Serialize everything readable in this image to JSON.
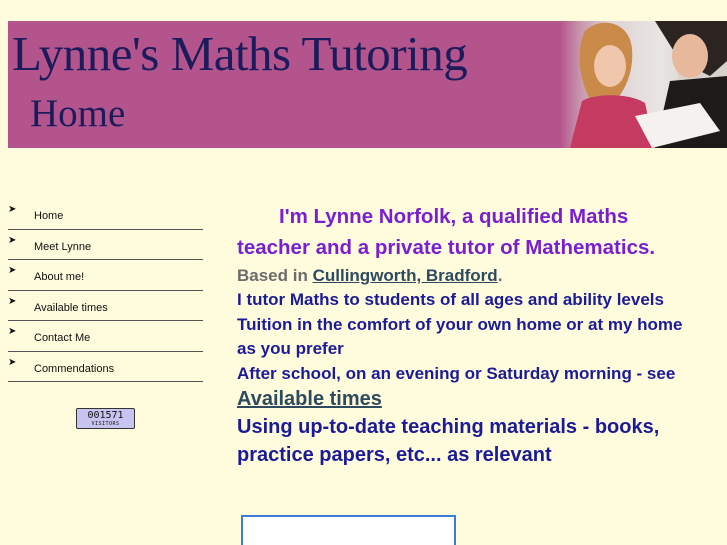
{
  "header": {
    "title": "Lynne's Maths Tutoring",
    "subtitle": "Home"
  },
  "nav": {
    "items": [
      {
        "label": "Home"
      },
      {
        "label": "Meet Lynne"
      },
      {
        "label": "About me!"
      },
      {
        "label": "Available times"
      },
      {
        "label": "Contact Me"
      },
      {
        "label": "Commendations"
      }
    ]
  },
  "counter": {
    "value": "001571",
    "label": "VISITORS"
  },
  "main": {
    "intro_line1": "I'm Lynne Norfolk, a qualified Maths",
    "intro_line2": "teacher and a private tutor of Mathematics.",
    "based_prefix": "Based in ",
    "based_link": "Cullingworth, Bradford",
    "based_suffix": ".",
    "line1": "I tutor Maths to students of all ages and ability levels",
    "line2": "Tuition in the comfort of your own home or at my home",
    "line3": "as you prefer",
    "line4": "After school, on an evening or Saturday morning - see",
    "available_link": "Available times",
    "line5": "Using up-to-date teaching materials - books,",
    "line6": "practice papers, etc... as relevant"
  },
  "colors": {
    "page_background": "#fffcdd",
    "banner_background": "#b4548c",
    "banner_text": "#1c1c5c",
    "intro_text": "#7a1fd0",
    "body_text": "#1b1b96",
    "link": "#2e4a5e"
  }
}
